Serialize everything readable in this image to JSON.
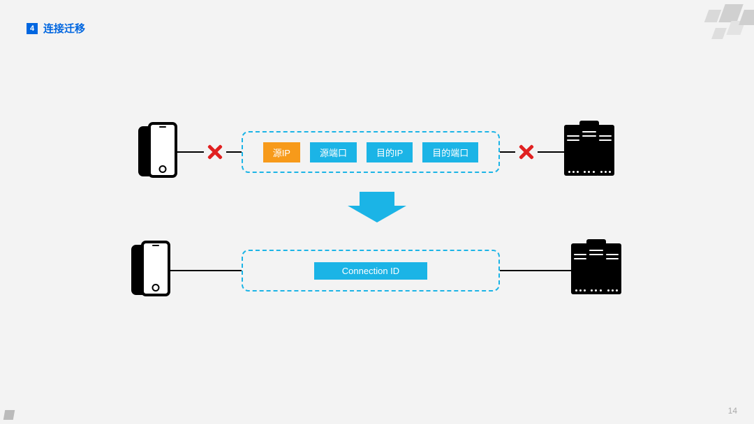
{
  "header": {
    "section_number": "4",
    "title": "连接迁移"
  },
  "row1": {
    "tags": {
      "source_ip": "源IP",
      "source_port": "源端口",
      "dest_ip": "目的IP",
      "dest_port": "目的端口"
    }
  },
  "row2": {
    "tag": "Connection ID"
  },
  "page_number": "14"
}
